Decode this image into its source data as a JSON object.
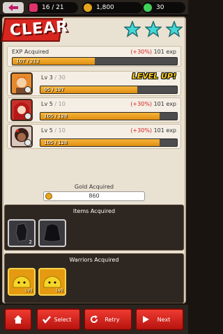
{
  "topbar": {
    "stamina": "16 / 21",
    "gold": "1,800",
    "gems": "30"
  },
  "result": {
    "banner": "CLEAR",
    "stars": 3
  },
  "exp": {
    "title": "EXP Acquired",
    "bonus": "(+30%)",
    "amount": "101 exp",
    "bar_text": "107 / 212",
    "progress": 0.5
  },
  "heroes": [
    {
      "level": "Lv 3",
      "max": "/ 30",
      "bar_text": "95 / 197",
      "progress": 0.71,
      "levelup": "LEVEL UP!",
      "exp_bonus": "",
      "exp_amount": ""
    },
    {
      "level": "Lv 5",
      "max": "/ 10",
      "bar_text": "105 / 128",
      "progress": 0.87,
      "levelup": "",
      "exp_bonus": "(+30%)",
      "exp_amount": "101 exp"
    },
    {
      "level": "Lv 5",
      "max": "/ 10",
      "bar_text": "105 / 128",
      "progress": 0.87,
      "levelup": "",
      "exp_bonus": "(+30%)",
      "exp_amount": "101 exp"
    }
  ],
  "gold_section": {
    "label": "Gold Acquired",
    "value": "860"
  },
  "items_section": {
    "title": "Items Acquired",
    "items": [
      {
        "icon": "dark-stone-icon",
        "count": "2"
      },
      {
        "icon": "dark-cloak-icon",
        "count": ""
      }
    ]
  },
  "warriors_section": {
    "title": "Warriors Acquired",
    "warriors": [
      {
        "icon": "yellow-slime-icon",
        "level": "Lv1"
      },
      {
        "icon": "yellow-slime-icon",
        "level": "Lv1"
      }
    ]
  },
  "buttons": {
    "home_icon": "home-icon",
    "select": "Select",
    "retry": "Retry",
    "next": "Next"
  },
  "colors": {
    "accent_red": "#d8261f",
    "exp_bar": "#f0a726",
    "star": "#41d8d6"
  }
}
